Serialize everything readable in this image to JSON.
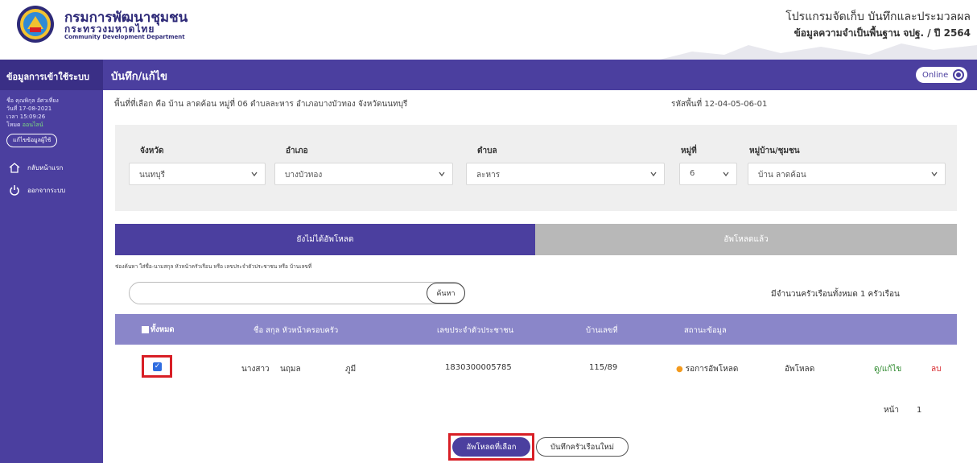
{
  "header": {
    "org_th": "กรมการพัฒนาชุมชน",
    "org_ministry": "กระทรวงมหาดไทย",
    "org_en": "Community Development Department",
    "program_title": "โปรแกรมจัดเก็บ บันทึกและประมวลผล",
    "program_subtitle": "ข้อมูลความจำเป็นพื้นฐาน จปฐ. / ปี 2564"
  },
  "sidebar": {
    "title": "ข้อมูลการเข้าใช้ระบบ",
    "user_name": "ชื่อ คุณพิกุล อัศวเที่ยง",
    "date": "วันที่ 17-08-2021",
    "time": "เวลา 15:09:26",
    "mode_label": "โหมด",
    "mode_value": "ออนไลน์",
    "edit_user_label": "แก้ไขข้อมูลผู้ใช้",
    "items": [
      {
        "label": "กลับหน้าแรก",
        "icon": "home-icon"
      },
      {
        "label": "ออกจากระบบ",
        "icon": "power-icon"
      }
    ]
  },
  "titlebar": {
    "title": "บันทึก/แก้ไข",
    "online_label": "Online"
  },
  "area": {
    "selected_text": "พื้นที่ที่เลือก คือ บ้าน ลาดค้อน หมู่ที่ 06 ตำบลละหาร อำเภอบางบัวทอง จังหวัดนนทบุรี",
    "area_code": "รหัสพื้นที่ 12-04-05-06-01"
  },
  "filters": {
    "province_label": "จังหวัด",
    "province_value": "นนทบุรี",
    "district_label": "อำเภอ",
    "district_value": "บางบัวทอง",
    "subdistrict_label": "ตำบล",
    "subdistrict_value": "ละหาร",
    "moo_label": "หมู่ที่",
    "moo_value": "6",
    "village_label": "หมู่บ้าน/ชุมชน",
    "village_value": "บ้าน ลาดค้อน"
  },
  "tabs": [
    {
      "label": "ยังไม่ได้อัพโหลด",
      "active": true
    },
    {
      "label": "อัพโหลดแล้ว",
      "active": false
    }
  ],
  "search": {
    "hint": "ช่องค้นหา ใส่ชื่อ-นามสกุล หัวหน้าครัวเรือน หรือ เลขประจำตัวประชาชน หรือ บ้านเลขที่",
    "value": "",
    "button_label": "ค้นหา",
    "count_text": "มีจำนวนครัวเรือนทั้งหมด 1 ครัวเรือน"
  },
  "table": {
    "headers": {
      "all": "ทั้งหมด",
      "name": "ชื่อ สกุล หัวหน้าครอบครัว",
      "id": "เลขประจำตัวประชาชน",
      "house_no": "บ้านเลขที่",
      "status": "สถานะข้อมูล"
    },
    "rows": [
      {
        "checked": true,
        "title": "นางสาว",
        "first_name": "นฤมล",
        "last_name": "ภูมี",
        "citizen_id": "1830300005785",
        "house_no": "115/89",
        "status": "รอการอัพโหลด",
        "action_upload": "อัพโหลด",
        "action_view": "ดู/แก้ไข",
        "action_delete": "ลบ"
      }
    ]
  },
  "pager": {
    "label": "หน้า",
    "page": "1"
  },
  "actions": {
    "upload_selected": "อัพโหลดที่เลือก",
    "new_household": "บันทึกครัวเรือนใหม่"
  },
  "colors": {
    "primary": "#4b3f9f",
    "table_header": "#8a86c9",
    "highlight": "#d81f26",
    "status_pending": "#f39a1e"
  }
}
